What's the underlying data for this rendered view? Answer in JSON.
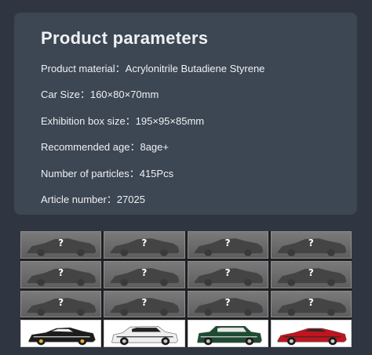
{
  "panel": {
    "title": "Product parameters",
    "rows": [
      "Product material：Acrylonitrile Butadiene Styrene",
      "Car Size：160×80×70mm",
      "Exhibition box size：195×95×85mm",
      "Recommended age：8age+",
      "Number of particles：415Pcs",
      "Article number：27025"
    ]
  },
  "blind_box": {
    "mystery_mark": "?",
    "revealed_cars": [
      {
        "icon": "black-race-car-icon",
        "body": "#1c1c1c",
        "accent": "#f2f2f2",
        "wheel_rim": "#e0b62a"
      },
      {
        "icon": "white-suv-icon",
        "body": "#eeeeee",
        "accent": "#222222",
        "wheel_rim": "#c9c9c9"
      },
      {
        "icon": "green-hatchback-icon",
        "body": "#1f4a32",
        "accent": "#e8e8e8",
        "wheel_rim": "#bdbdbd"
      },
      {
        "icon": "red-supercar-icon",
        "body": "#c0141e",
        "accent": "#2a2a2a",
        "wheel_rim": "#cccccc"
      }
    ]
  }
}
